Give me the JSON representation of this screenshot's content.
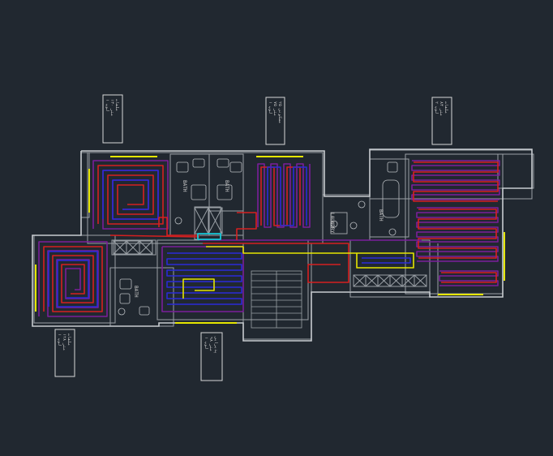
{
  "drawing": {
    "background": "#212830",
    "colors": {
      "wall": "#9aa0a6",
      "outer": "#c8ccd0",
      "loop_red": "#d62020",
      "loop_blue": "#2a2ad8",
      "loop_purple": "#7a1f9a",
      "loop_yellow": "#e6e600",
      "header_cyan": "#16c8d8",
      "label_box": "#d8d8d8",
      "label_text": "#c8c8c8"
    },
    "tags": [
      {
        "id": "t1",
        "lines": [
          "ملفات",
          "۱۳۰ متر",
          "۱ لوپ"
        ]
      },
      {
        "id": "t2",
        "lines": [
          "مسکونی ۲۵",
          "۷۵ متر",
          "۱ لوپ"
        ]
      },
      {
        "id": "t3",
        "lines": [
          "ملفات",
          "۸۴ متر",
          "۲ لوپ"
        ]
      },
      {
        "id": "t4",
        "lines": [
          "ملفات",
          "۱۲۸ متر",
          "۱ لوپ"
        ]
      },
      {
        "id": "t5",
        "lines": [
          "پذیرایی",
          "۹۸ متر",
          "۱ لوپ"
        ]
      }
    ],
    "room_labels": {
      "bath1": "BATH",
      "bath2": "BATH",
      "bath3": "BATH",
      "bath4": "BATH",
      "laundry": "LAUNDRY"
    }
  }
}
